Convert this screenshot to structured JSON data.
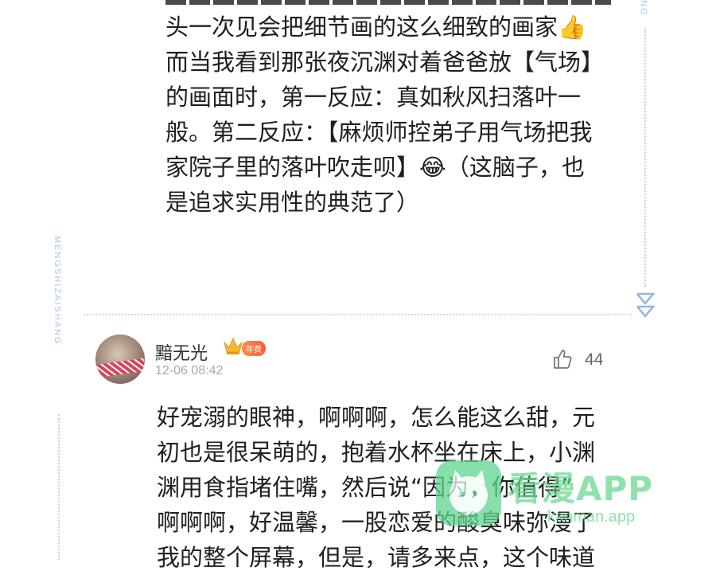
{
  "decor": {
    "left_vertical": "MENGSHIZAISHANG",
    "right_vertical": "NG"
  },
  "comment1": {
    "lines": [
      "头一次见会把细节画的这么细致的画家👍",
      "而当我看到那张夜沉渊对着爸爸放【气场】",
      "的画面时，第一反应：真如秋风扫落叶一",
      "般。第二反应：【麻烦师控弟子用气场把我",
      "家院子里的落叶吹走呗】😂（这脑子，也",
      "是追求实用性的典范了）"
    ]
  },
  "comment2": {
    "username": "黯无光",
    "badge": "年费",
    "timestamp": "12-06 08:42",
    "likes": "44",
    "lines": [
      "好宠溺的眼神，啊啊啊，怎么能这么甜，元",
      "初也是很呆萌的，抱着水杯坐在床上，小渊",
      "渊用食指堵住嘴，然后说“因为，你值得”",
      "啊啊啊，好温馨，一股恋爱的酸臭味弥漫了",
      "我的整个屏幕，但是，请多来点，这个味道"
    ]
  },
  "watermark": {
    "title": "看漫APP",
    "url": "kanman.app"
  }
}
